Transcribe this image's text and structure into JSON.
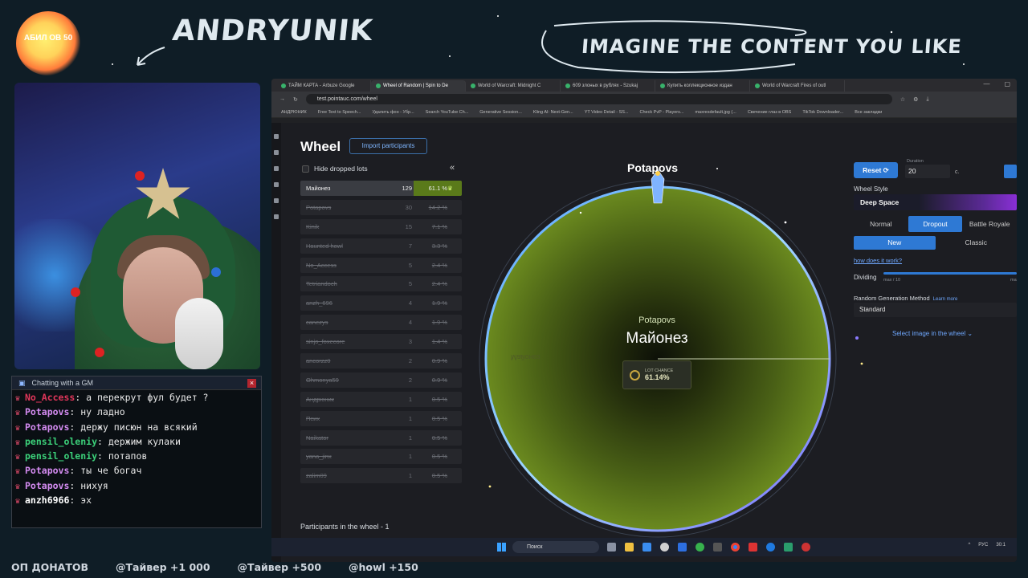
{
  "overlay": {
    "streamer_name": "ANDRYUNIK",
    "tagline": "IMAGINE THE CONTENT YOU LIKE",
    "logo_text": "АБИЛ\nОВ\n50"
  },
  "chat": {
    "header": "Chatting with a GM",
    "messages": [
      {
        "name": "No_Access",
        "text": ": а перекрут фул будет ?",
        "color": "#e0365a"
      },
      {
        "name": "Potapovs",
        "text": ": ну ладно",
        "color": "#d58cf2"
      },
      {
        "name": "Potapovs",
        "text": ": держу писюн на всякий",
        "color": "#d58cf2"
      },
      {
        "name": "pensil_oleniy",
        "text": ": держим кулаки",
        "color": "#3cd17a"
      },
      {
        "name": "pensil_oleniy",
        "text": ": потапов",
        "color": "#3cd17a"
      },
      {
        "name": "Potapovs",
        "text": ": ты че богач",
        "color": "#d58cf2"
      },
      {
        "name": "Potapovs",
        "text": ": нихуя",
        "color": "#d58cf2"
      },
      {
        "name": "anzh6966",
        "text": ": эх",
        "color": "#ffffff"
      }
    ]
  },
  "ticker": [
    "ОП ДОНАТОВ",
    "@Тайвер +1 000",
    "@Тайвер +500",
    "@howl +150"
  ],
  "browser": {
    "tabs": [
      {
        "label": "ТАЙМ КАРТА - Arbuze Google",
        "active": false
      },
      {
        "label": "Wheel of Random | Spin to De",
        "active": true
      },
      {
        "label": "World of Warcraft: Midnight C",
        "active": false
      },
      {
        "label": "609 злоных в рублях - Szukaj",
        "active": false
      },
      {
        "label": "Купить коллекционное издан",
        "active": false
      },
      {
        "label": "World of Warcraft Fires of outl",
        "active": false
      }
    ],
    "url": "test.pointauc.com/wheel",
    "bookmarks": [
      "АНДРЮНИК",
      "Free Text to Speech...",
      "Удалить фон - Убр...",
      "Search YouTube Ch...",
      "Generative Session...",
      "Kling AI: Next-Gen...",
      "YT Video Detail - SS...",
      "Check PvP - Players...",
      "maxresdefault.jpg (...",
      "Свечение глаз в OBS",
      "TikTok Downloader...",
      "Все закладки"
    ]
  },
  "app": {
    "title": "Wheel",
    "import_label": "Import participants",
    "hide_dropped_label": "Hide dropped lots",
    "collapse_icon": "«",
    "lots": [
      {
        "name": "Майонез",
        "amount": "129",
        "percent": "61.1 %"
      },
      {
        "name": "Potapovs",
        "amount": "30",
        "percent": "14.2 %"
      },
      {
        "name": "Kinik",
        "amount": "15",
        "percent": "7.1 %"
      },
      {
        "name": "Haunted howl",
        "amount": "7",
        "percent": "3.3 %"
      },
      {
        "name": "No_Access",
        "amount": "5",
        "percent": "2.4 %"
      },
      {
        "name": "Tetriandoch",
        "amount": "5",
        "percent": "2.4 %"
      },
      {
        "name": "anzh_696",
        "amount": "4",
        "percent": "1.9 %"
      },
      {
        "name": "canezys",
        "amount": "4",
        "percent": "1.9 %"
      },
      {
        "name": "sinjo_foxecore",
        "amount": "3",
        "percent": "1.4 %"
      },
      {
        "name": "ancorzz0",
        "amount": "2",
        "percent": "0.9 %"
      },
      {
        "name": "Ohmonya59",
        "amount": "2",
        "percent": "0.9 %"
      },
      {
        "name": "Андрюник",
        "amount": "1",
        "percent": "0.5 %"
      },
      {
        "name": "Псих",
        "amount": "1",
        "percent": "0.5 %"
      },
      {
        "name": "Naikator",
        "amount": "1",
        "percent": "0.5 %"
      },
      {
        "name": "yana_jinx",
        "amount": "1",
        "percent": "0.5 %"
      },
      {
        "name": "zalim09",
        "amount": "1",
        "percent": "0.5 %"
      }
    ],
    "participants_label": "Participants in the wheel - 1",
    "wheel": {
      "top_name": "Potapovs",
      "center_small": "Potapovs",
      "center_big": "Майонез",
      "mirror_label": "Майонез",
      "chance_label": "LOT CHANCE",
      "chance_value": "61.14%"
    },
    "settings": {
      "reset_label": "Reset",
      "duration_label": "Duration",
      "duration_value": "20",
      "duration_unit": "с.",
      "wheel_style_label": "Wheel Style",
      "wheel_style_value": "Deep Space",
      "modes": [
        "Normal",
        "Dropout",
        "Battle Royale"
      ],
      "active_mode": "Dropout",
      "sub_modes": [
        "New",
        "Classic"
      ],
      "active_sub_mode": "New",
      "how_link": "how does it work?",
      "dividing_label": "Dividing",
      "dividing_min": "max / 10",
      "dividing_max": "max",
      "rgm_label": "Random Generation Method",
      "rgm_learn": "Learn more",
      "rgm_value": "Standard",
      "select_image": "Select image in the wheel"
    }
  },
  "taskbar": {
    "search_placeholder": "Поиск",
    "lang": "РУС",
    "time": "30:1"
  }
}
